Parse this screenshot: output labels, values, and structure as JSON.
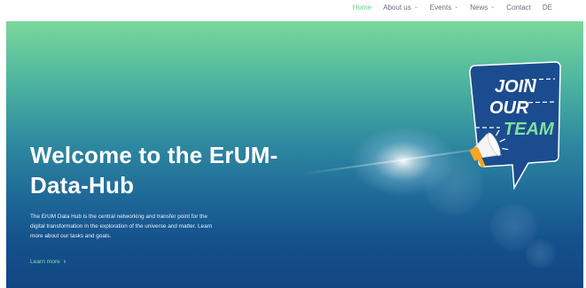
{
  "nav": {
    "items": [
      {
        "label": "Home",
        "active": true,
        "dropdown": false
      },
      {
        "label": "About us",
        "active": false,
        "dropdown": true
      },
      {
        "label": "Events",
        "active": false,
        "dropdown": true
      },
      {
        "label": "News",
        "active": false,
        "dropdown": true
      },
      {
        "label": "Contact",
        "active": false,
        "dropdown": false
      },
      {
        "label": "DE",
        "active": false,
        "dropdown": false
      }
    ],
    "active_color": "#5fd28a",
    "text_color": "#6b6f80"
  },
  "hero": {
    "title_line1": "Welcome to the ErUM-",
    "title_line2": "Data-Hub",
    "description_line1": "The ErUM Data Hub is the central networking and transfer point for the",
    "description_line2": "digital transformation in the exploration of the universe and matter. Learn",
    "description_line3": "more about our tasks and goals.",
    "link_label": "Learn more",
    "link_arrow": "›",
    "gradient_top": "#7bd79a",
    "gradient_bottom": "#114682",
    "link_color": "#7fe0a0"
  },
  "join_badge": {
    "line1": "JOIN",
    "line2": "OUR",
    "line3": "TEAM",
    "icon": "megaphone-icon",
    "bubble_color": "#1b4c8f",
    "accent_color": "#7fe0a0"
  },
  "icons": {
    "dropdown": "chevron-down-icon",
    "link_arrow": "chevron-right-icon"
  }
}
